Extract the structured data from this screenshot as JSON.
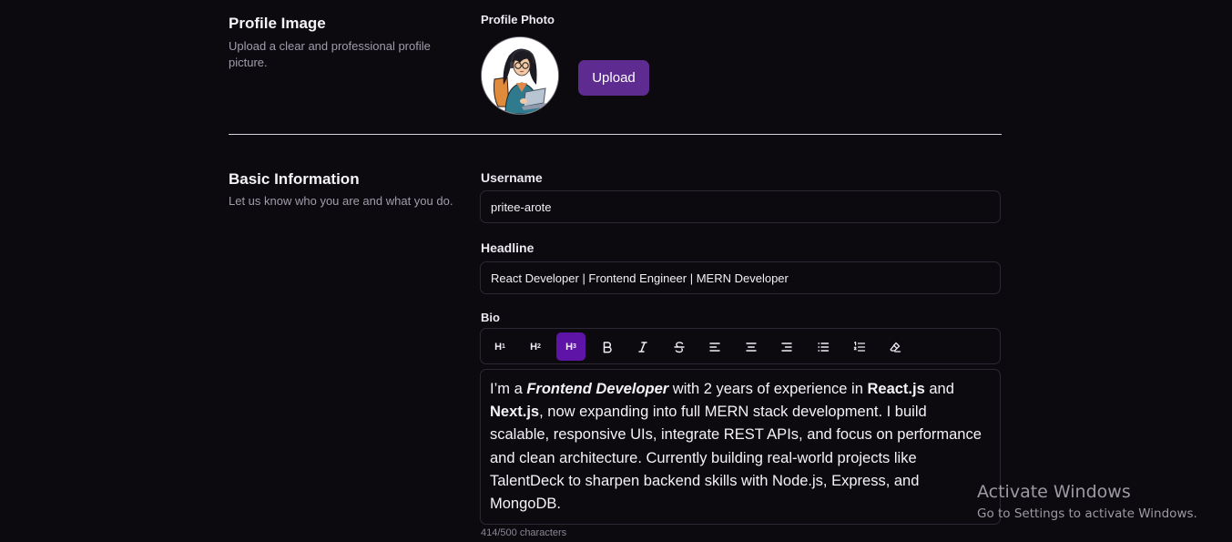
{
  "profile_image": {
    "title": "Profile Image",
    "description": "Upload a clear and professional profile picture.",
    "photo_label": "Profile Photo",
    "upload_label": "Upload",
    "accent": "#5e2b90"
  },
  "basic_info": {
    "title": "Basic Information",
    "description": "Let us know who you are and what you do.",
    "username_label": "Username",
    "username_value": "pritee-arote",
    "headline_label": "Headline",
    "headline_value": "React Developer | Frontend Engineer | MERN Developer",
    "bio_label": "Bio",
    "toolbar": {
      "active_color": "#5f14a8",
      "buttons": [
        {
          "name": "heading-1-button",
          "label": "H",
          "sub": "1",
          "active": false
        },
        {
          "name": "heading-2-button",
          "label": "H",
          "sub": "2",
          "active": false
        },
        {
          "name": "heading-3-button",
          "label": "H",
          "sub": "3",
          "active": true
        },
        {
          "name": "bold-icon",
          "active": false
        },
        {
          "name": "italic-icon",
          "active": false
        },
        {
          "name": "strikethrough-icon",
          "active": false
        },
        {
          "name": "align-left-icon",
          "active": false
        },
        {
          "name": "align-center-icon",
          "active": false
        },
        {
          "name": "align-right-icon",
          "active": false
        },
        {
          "name": "bullet-list-icon",
          "active": false
        },
        {
          "name": "ordered-list-icon",
          "active": false
        },
        {
          "name": "clear-format-icon",
          "active": false
        }
      ]
    },
    "bio": {
      "t1": "I’m a ",
      "b1": "Frontend Developer",
      "t2": " with 2 years of experience in ",
      "b2": "React.js",
      "t3": " and ",
      "b3": "Next.js",
      "t4": ", now expanding into full MERN stack development. I build scalable, responsive UIs, integrate REST APIs, and focus on performance and clean architecture. Currently building real-world projects like TalentDeck to sharpen backend skills with Node.js, Express, and MongoDB."
    },
    "char_count": "414/500 characters"
  },
  "watermark": {
    "title": "Activate Windows",
    "subtitle": "Go to Settings to activate Windows."
  }
}
